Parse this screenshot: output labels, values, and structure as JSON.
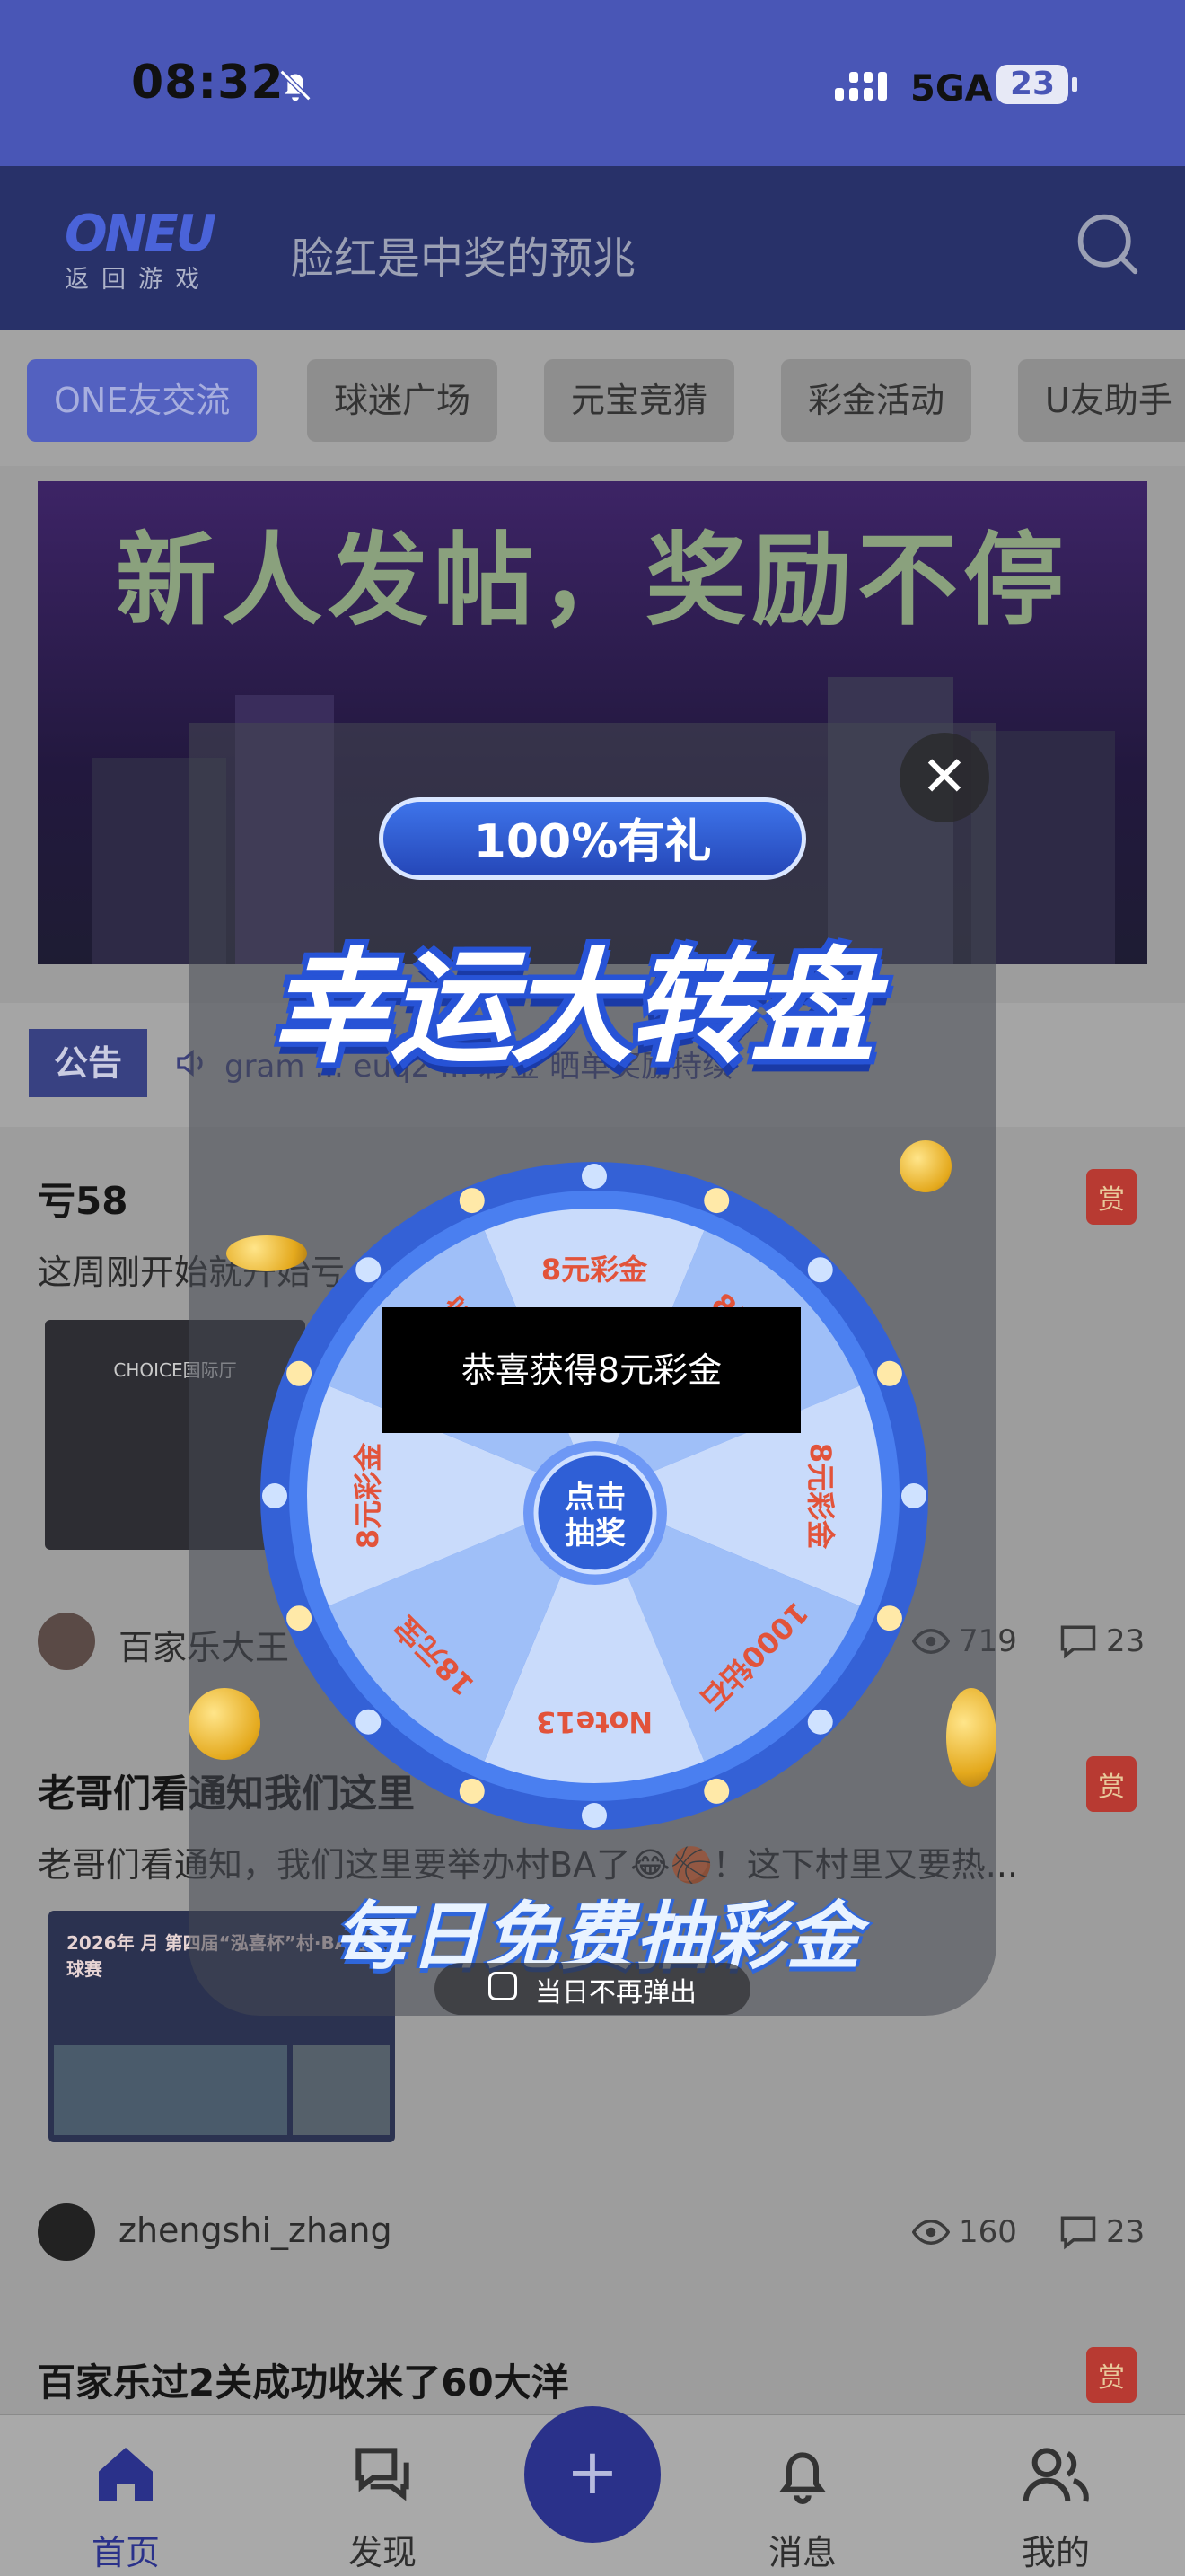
{
  "status_bar": {
    "time": "08:32",
    "network": "5GA",
    "battery": "23"
  },
  "header": {
    "logo_text": "ONEU",
    "logo_sub": "返回游戏",
    "title": "脸红是中奖的预兆"
  },
  "tabs": [
    {
      "label": "ONE友交流"
    },
    {
      "label": "球迷广场"
    },
    {
      "label": "元宝竞猜"
    },
    {
      "label": "彩金活动"
    },
    {
      "label": "U友助手"
    }
  ],
  "banner": {
    "title": "新人发帖，奖励不停"
  },
  "notice": {
    "tag": "公告",
    "text": "gram ... euq2 ... 彩金 晒单奖励持续"
  },
  "posts": [
    {
      "title": "亏58",
      "excerpt": "这周刚开始就开始亏 ... 就直接三连跪，...",
      "reward": "赏",
      "thumb_caption": "CHOICE国际厅",
      "user": "百家乐大王",
      "views": "719",
      "comments": "23"
    },
    {
      "title": "老哥们看通知我们这里",
      "excerpt": "老哥们看通知，我们这里要举办村BA了😂🏀！这下村里又要热...",
      "reward": "赏",
      "thumb_caption": "2026年 月 第四届“泓喜杯”村·BA篮球赛",
      "user": "zhengshi_zhang",
      "views": "160",
      "comments": "23"
    },
    {
      "title": "百家乐过2关成功收米了60大洋",
      "reward": "赏"
    }
  ],
  "bottom_nav": [
    {
      "label": "首页",
      "icon": "home-icon"
    },
    {
      "label": "发现",
      "icon": "chat-bubbles-icon"
    },
    {
      "label": "+",
      "icon": "plus-icon"
    },
    {
      "label": "消息",
      "icon": "bell-icon"
    },
    {
      "label": "我的",
      "icon": "users-icon"
    }
  ],
  "lucky_wheel": {
    "badge": "100%有礼",
    "title": "幸运大转盘",
    "spin_button": "点击\n抽奖",
    "toast": "恭喜获得8元彩金",
    "prizes": [
      "8元彩金",
      "8元彩金",
      "8元彩金",
      "1000钻石",
      "Note13",
      "18元宝",
      "8元彩金",
      "18元宝"
    ],
    "footer_banner": "每日免费抽彩金",
    "no_popup_label": "当日不再弹出"
  },
  "colors": {
    "status_bar": "#4956b6",
    "header": "#283169",
    "accent": "#5361c0",
    "wheel_blue": "#3b6fe0"
  }
}
